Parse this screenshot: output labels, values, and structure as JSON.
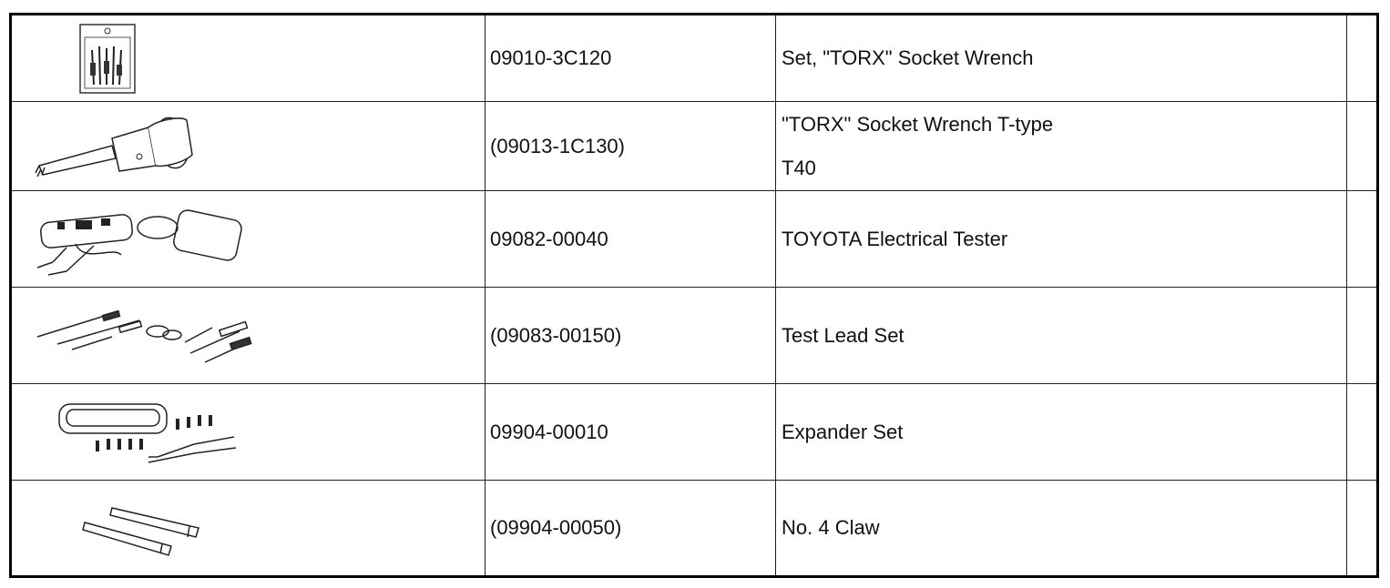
{
  "rows": [
    {
      "icon": "torx-socket-wrench-set-icon",
      "part_number": "09010-3C120",
      "name": "Set, \"TORX\" Socket Wrench",
      "detail": ""
    },
    {
      "icon": "torx-t-type-wrench-icon",
      "part_number": "(09013-1C130)",
      "name": "\"TORX\" Socket Wrench T-type",
      "detail": "T40"
    },
    {
      "icon": "electrical-tester-icon",
      "part_number": "09082-00040",
      "name": "TOYOTA Electrical Tester",
      "detail": ""
    },
    {
      "icon": "test-lead-set-icon",
      "part_number": "(09083-00150)",
      "name": "Test Lead Set",
      "detail": ""
    },
    {
      "icon": "expander-set-icon",
      "part_number": "09904-00010",
      "name": "Expander Set",
      "detail": ""
    },
    {
      "icon": "claw-tool-icon",
      "part_number": "(09904-00050)",
      "name": "No. 4 Claw",
      "detail": ""
    }
  ]
}
